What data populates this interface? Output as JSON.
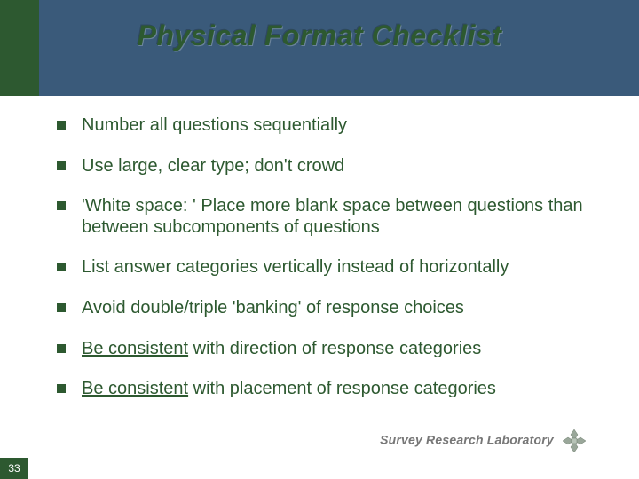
{
  "title": "Physical Format Checklist",
  "bullets": [
    {
      "segments": [
        {
          "text": "Number all questions sequentially"
        }
      ]
    },
    {
      "segments": [
        {
          "text": "Use large, clear type;  don't crowd"
        }
      ]
    },
    {
      "segments": [
        {
          "text": "'White space: ' Place more blank space between questions than between subcomponents of questions"
        }
      ]
    },
    {
      "segments": [
        {
          "text": "List answer categories vertically instead of horizontally"
        }
      ]
    },
    {
      "segments": [
        {
          "text": "Avoid double/triple 'banking' of response choices"
        }
      ]
    },
    {
      "segments": [
        {
          "text": "Be consistent",
          "underline": true
        },
        {
          "text": " with direction of response categories"
        }
      ]
    },
    {
      "segments": [
        {
          "text": "Be consistent",
          "underline": true
        },
        {
          "text": " with placement of response categories"
        }
      ]
    }
  ],
  "footer": {
    "lab": "Survey Research Laboratory",
    "slide_number": "33"
  },
  "colors": {
    "accent_green": "#2d5930",
    "band_blue": "#3a5a7a"
  }
}
